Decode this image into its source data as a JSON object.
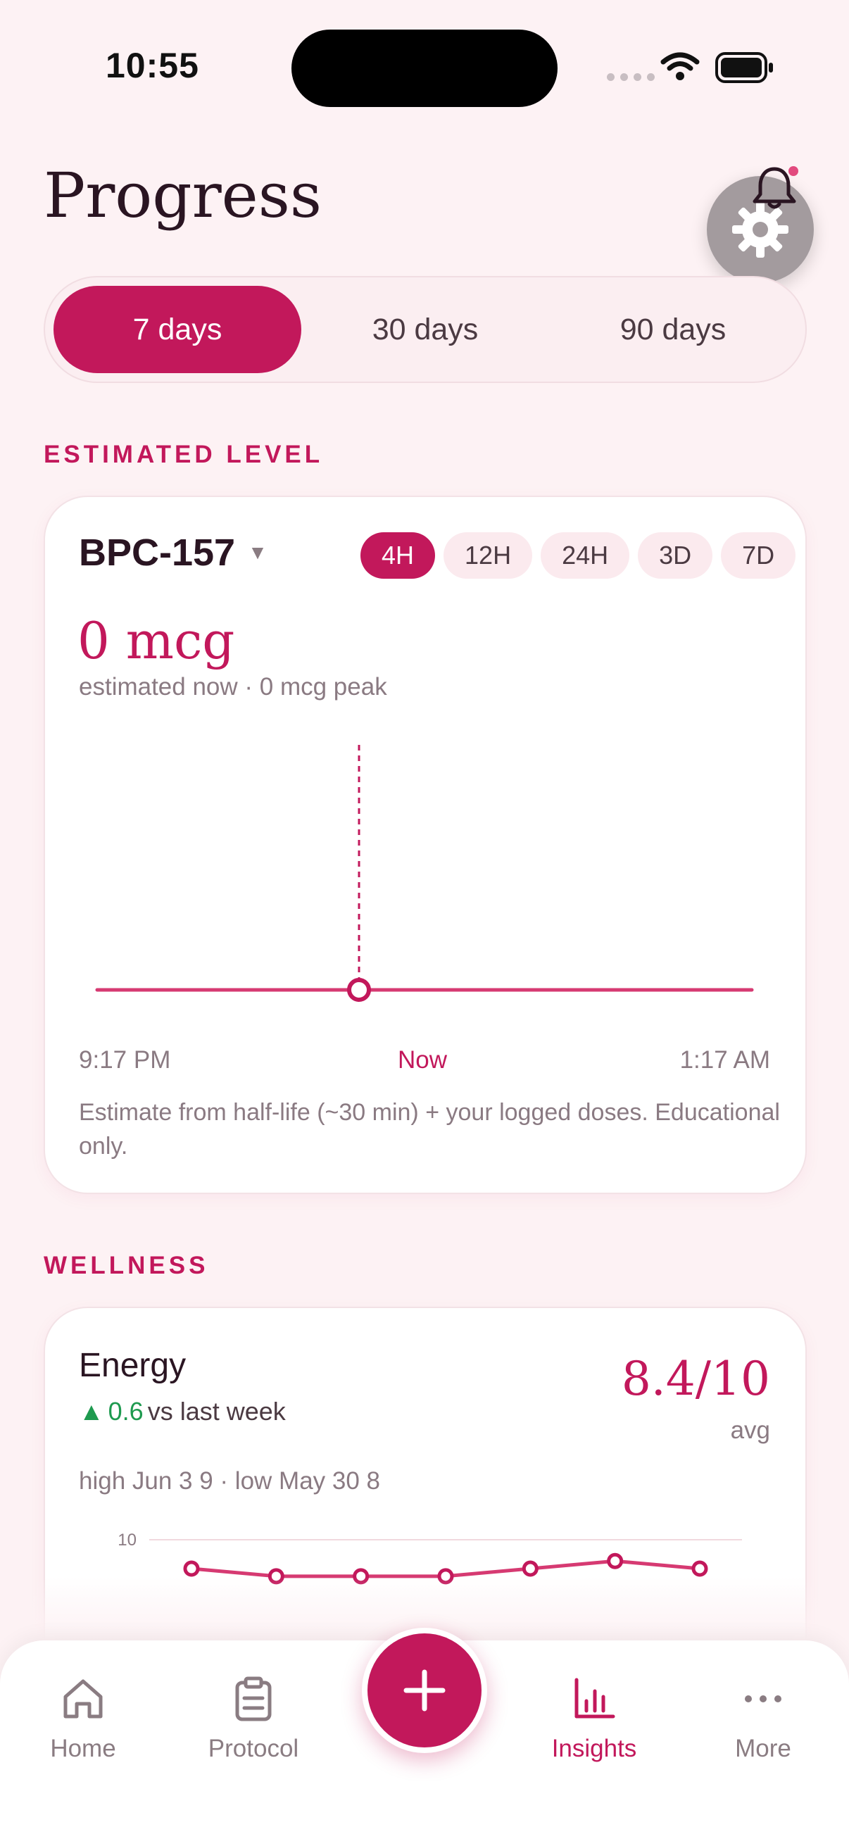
{
  "status": {
    "time": "10:55"
  },
  "header": {
    "title": "Progress"
  },
  "range": {
    "options": [
      "7 days",
      "30 days",
      "90 days"
    ],
    "selected": "7 days"
  },
  "estimated": {
    "section_label": "ESTIMATED LEVEL",
    "compound": "BPC-157",
    "windows": [
      "4H",
      "12H",
      "24H",
      "3D",
      "7D"
    ],
    "selected_window": "4H",
    "value": "0 mcg",
    "subtitle": "estimated now · 0 mcg peak",
    "axis": {
      "start": "9:17 PM",
      "now": "Now",
      "end": "1:17 AM"
    },
    "note": "Estimate from half-life (~30 min) + your logged doses. Educational only.",
    "accent": "#c2185b"
  },
  "wellness": {
    "section_label": "WELLNESS",
    "metric": {
      "name": "Energy",
      "delta": "0.6",
      "delta_suffix": "vs last week",
      "score": "8.4/10",
      "score_label": "avg",
      "range_text": "high Jun 3 9 · low May 30 8"
    }
  },
  "chart_data": {
    "type": "line",
    "series": [
      {
        "values": [
          8.1,
          7.6,
          7.6,
          7.6,
          8.1,
          8.6,
          8.1
        ]
      }
    ],
    "yticks": [
      "10"
    ],
    "ylim": [
      0,
      10
    ]
  },
  "tabbar": {
    "home": "Home",
    "protocol": "Protocol",
    "insights": "Insights",
    "more": "More",
    "active": "Insights"
  }
}
